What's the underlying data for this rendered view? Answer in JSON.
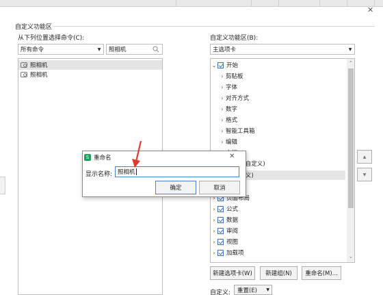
{
  "section_title": "自定义功能区",
  "left": {
    "choose_label": "从下列位置选择命令(C):",
    "combo_value": "所有命令",
    "search_value": "照相机",
    "commands": [
      "照相机",
      "照相机"
    ]
  },
  "right": {
    "label": "自定义功能区(B):",
    "combo_value": "主选项卡",
    "tree": [
      {
        "label": "开始",
        "expanded": true,
        "checkbox": true
      },
      {
        "label": "剪贴板"
      },
      {
        "label": "字体"
      },
      {
        "label": "对齐方式"
      },
      {
        "label": "数字"
      },
      {
        "label": "格式"
      },
      {
        "label": "智能工具箱"
      },
      {
        "label": "编辑"
      },
      {
        "label": "文档"
      },
      {
        "label": "选项卡(自定义)"
      },
      {
        "label": "组(自定义)"
      },
      {
        "label": ""
      },
      {
        "label": "页面布局",
        "checkbox": true
      },
      {
        "label": "公式",
        "checkbox": true
      },
      {
        "label": "数据",
        "checkbox": true
      },
      {
        "label": "审阅",
        "checkbox": true
      },
      {
        "label": "视图",
        "checkbox": true
      },
      {
        "label": "加载项",
        "checkbox": true
      }
    ],
    "buttons": {
      "new_tab": "新建选项卡(W)",
      "new_group": "新建组(N)",
      "rename": "重命名(M)..."
    },
    "customize_label": "自定义:",
    "reset_label": "重置(E)"
  },
  "dialog": {
    "title": "重命名",
    "name_label": "显示名称:",
    "name_value": "照相机",
    "ok": "确定",
    "cancel": "取消"
  },
  "colors": {
    "annotation_arrow": "#e23a2e",
    "accent": "#3b6fc9",
    "app_icon": "#1aa260"
  }
}
